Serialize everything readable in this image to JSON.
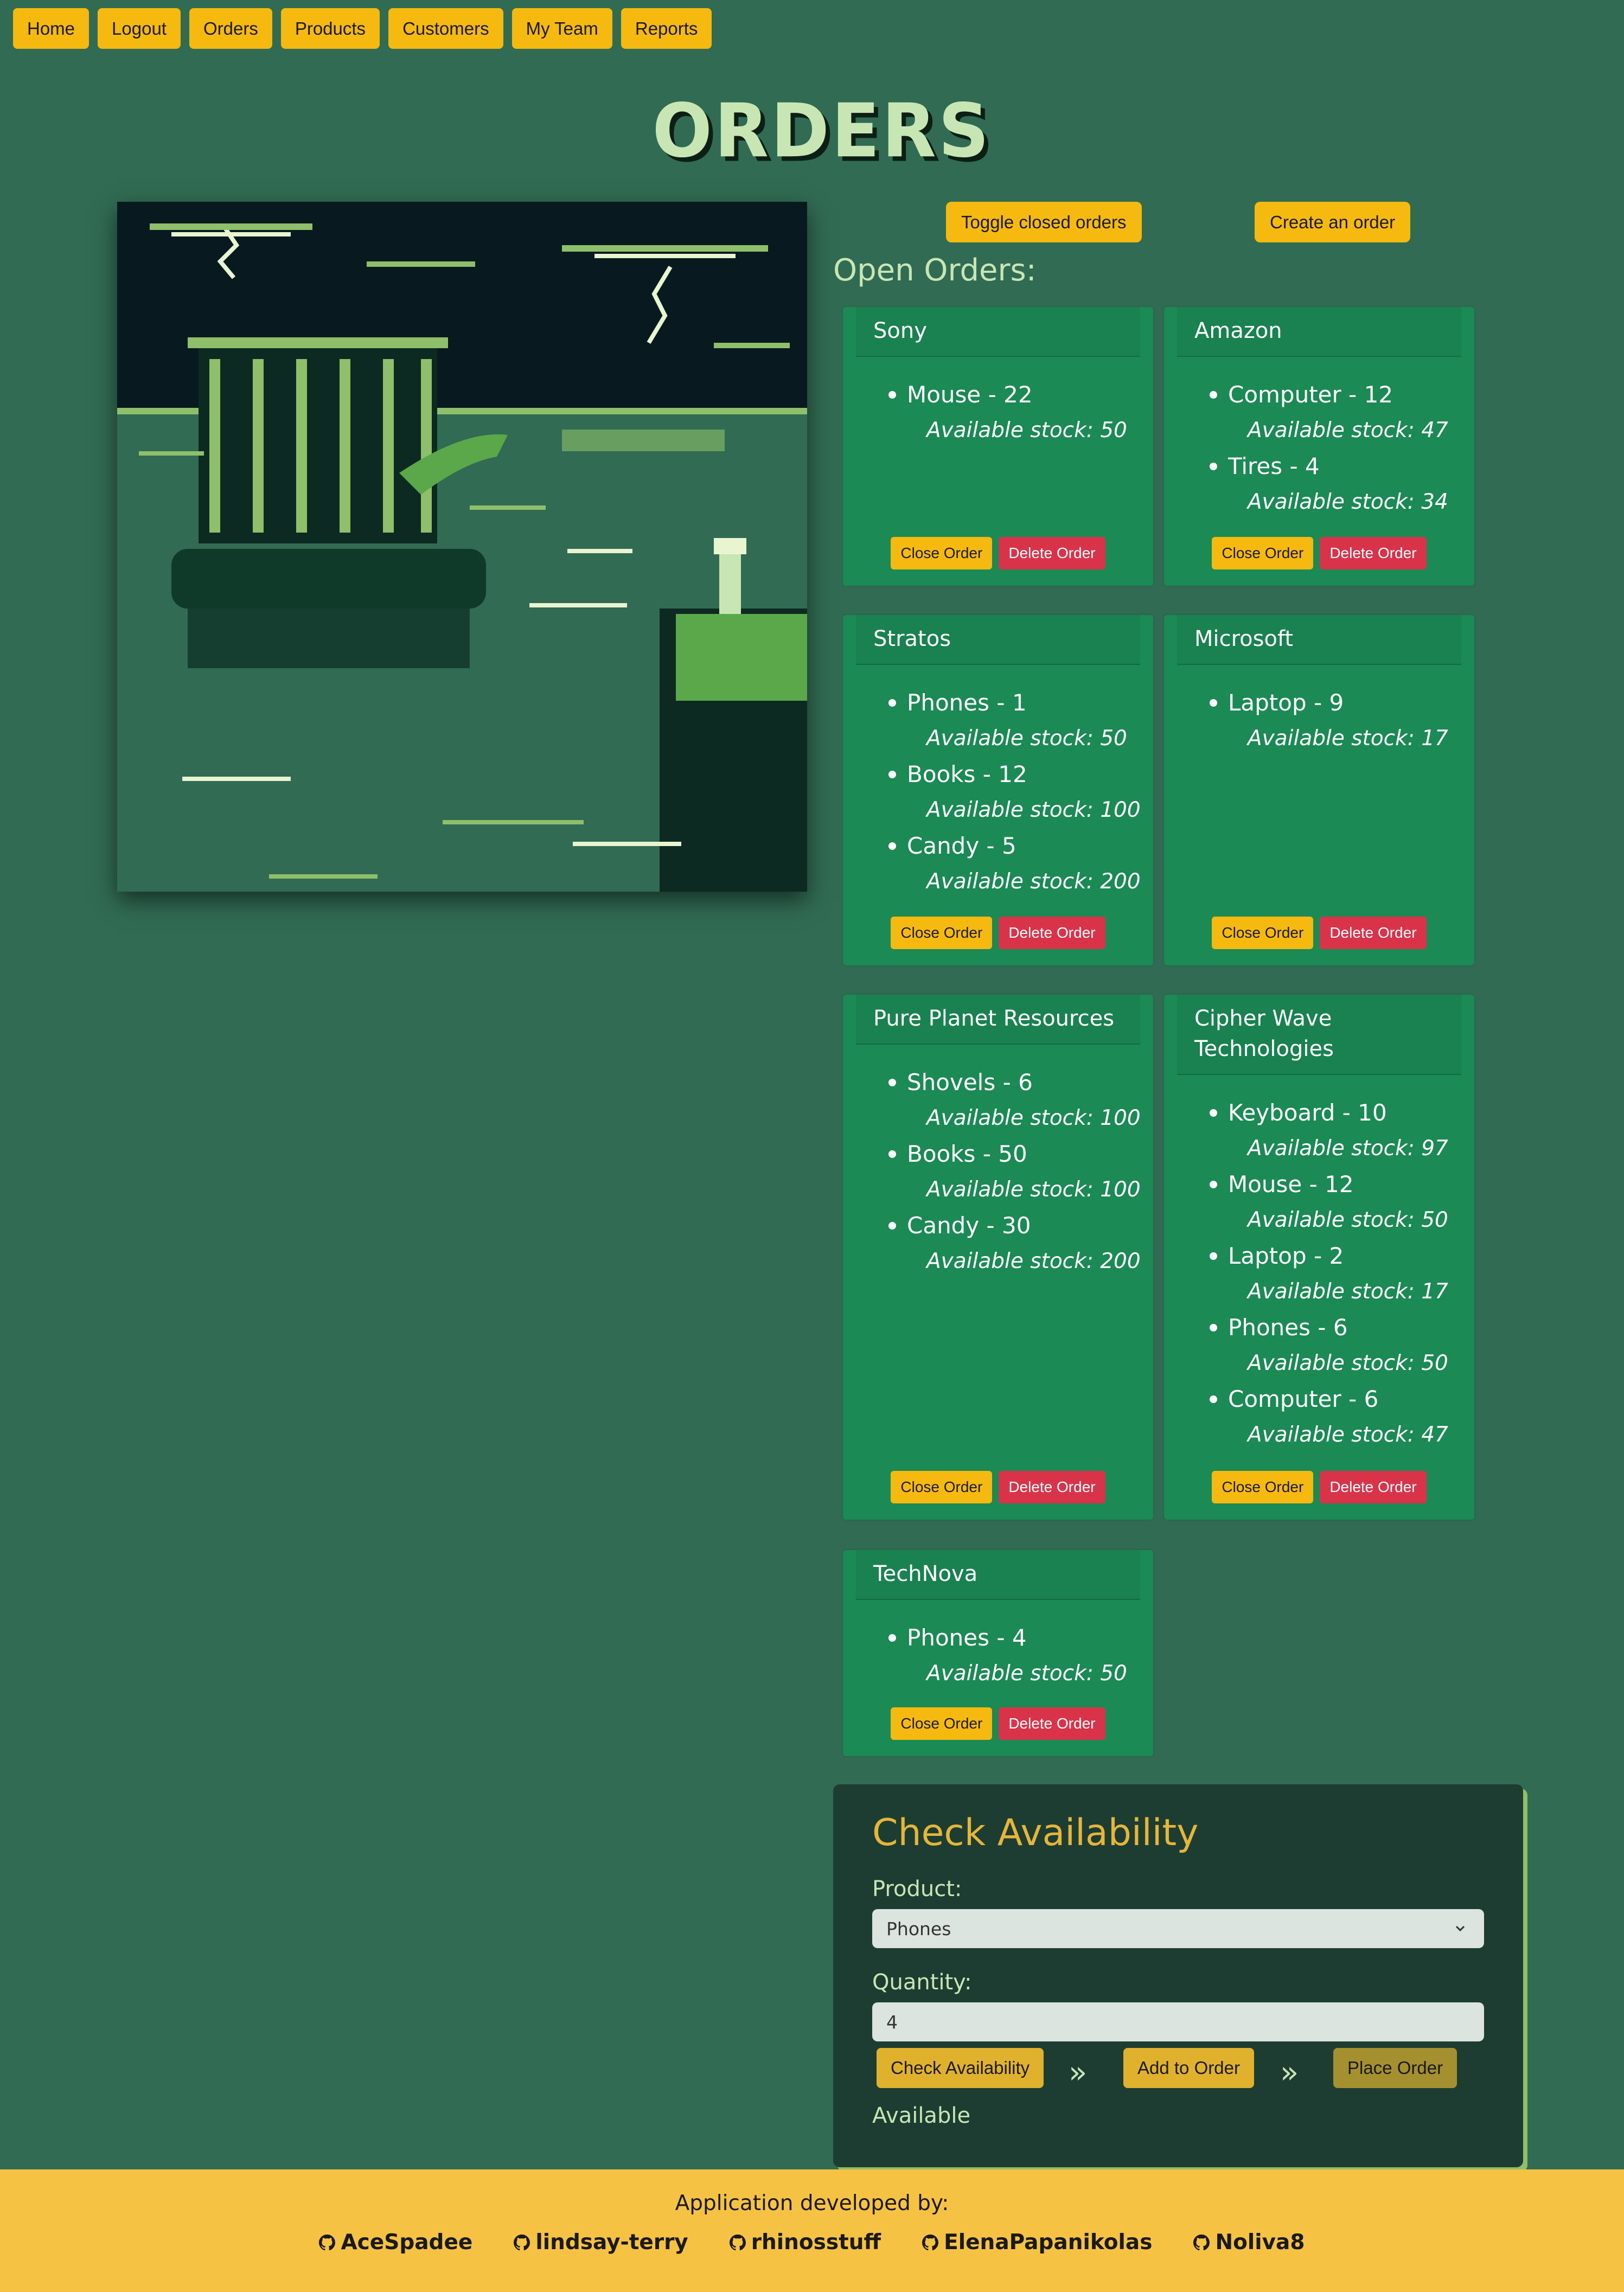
{
  "nav": [
    "Home",
    "Logout",
    "Orders",
    "Products",
    "Customers",
    "My Team",
    "Reports"
  ],
  "page_title": "ORDERS",
  "buttons": {
    "toggle_closed": "Toggle closed orders",
    "create_order": "Create an order"
  },
  "section_title": "Open Orders:",
  "orders": [
    {
      "customer": "Sony",
      "items": [
        {
          "line": "Mouse - 22",
          "stock": "Available stock: 50"
        }
      ]
    },
    {
      "customer": "Amazon",
      "items": [
        {
          "line": "Computer - 12",
          "stock": "Available stock: 47"
        },
        {
          "line": "Tires - 4",
          "stock": "Available stock: 34"
        }
      ]
    },
    {
      "customer": "Stratos",
      "items": [
        {
          "line": "Phones - 1",
          "stock": "Available stock: 50"
        },
        {
          "line": "Books - 12",
          "stock": "Available stock: 100"
        },
        {
          "line": "Candy - 5",
          "stock": "Available stock: 200"
        }
      ]
    },
    {
      "customer": "Microsoft",
      "items": [
        {
          "line": "Laptop - 9",
          "stock": "Available stock: 17"
        }
      ]
    },
    {
      "customer": "Pure Planet Resources",
      "items": [
        {
          "line": "Shovels - 6",
          "stock": "Available stock: 100"
        },
        {
          "line": "Books - 50",
          "stock": "Available stock: 100"
        },
        {
          "line": "Candy - 30",
          "stock": "Available stock: 200"
        }
      ]
    },
    {
      "customer": "Cipher Wave Technologies",
      "items": [
        {
          "line": "Keyboard - 10",
          "stock": "Available stock: 97"
        },
        {
          "line": "Mouse - 12",
          "stock": "Available stock: 50"
        },
        {
          "line": "Laptop - 2",
          "stock": "Available stock: 17"
        },
        {
          "line": "Phones - 6",
          "stock": "Available stock: 50"
        },
        {
          "line": "Computer - 6",
          "stock": "Available stock: 47"
        }
      ]
    },
    {
      "customer": "TechNova",
      "items": [
        {
          "line": "Phones - 4",
          "stock": "Available stock: 50"
        }
      ]
    }
  ],
  "order_actions": {
    "close": "Close Order",
    "delete": "Delete Order"
  },
  "availability": {
    "title": "Check Availability",
    "product_label": "Product:",
    "product_value": "Phones",
    "quantity_label": "Quantity:",
    "quantity_value": "4",
    "check_button": "Check Availability",
    "add_button": "Add to Order",
    "place_button": "Place Order",
    "arrow": "»",
    "status": "Available"
  },
  "footer": {
    "label": "Application developed by:",
    "developers": [
      "AceSpadee",
      "lindsay-terry",
      "rhinosstuff",
      "ElenaPapanikolas",
      "Noliva8"
    ]
  },
  "colors": {
    "background": "#316b53",
    "accent": "#f5b90f",
    "card": "#1b8a55",
    "danger": "#d9334a",
    "panel": "#1d3d33",
    "footer": "#f6c243"
  },
  "icons": [
    "github-icon",
    "chevron-down-icon"
  ]
}
